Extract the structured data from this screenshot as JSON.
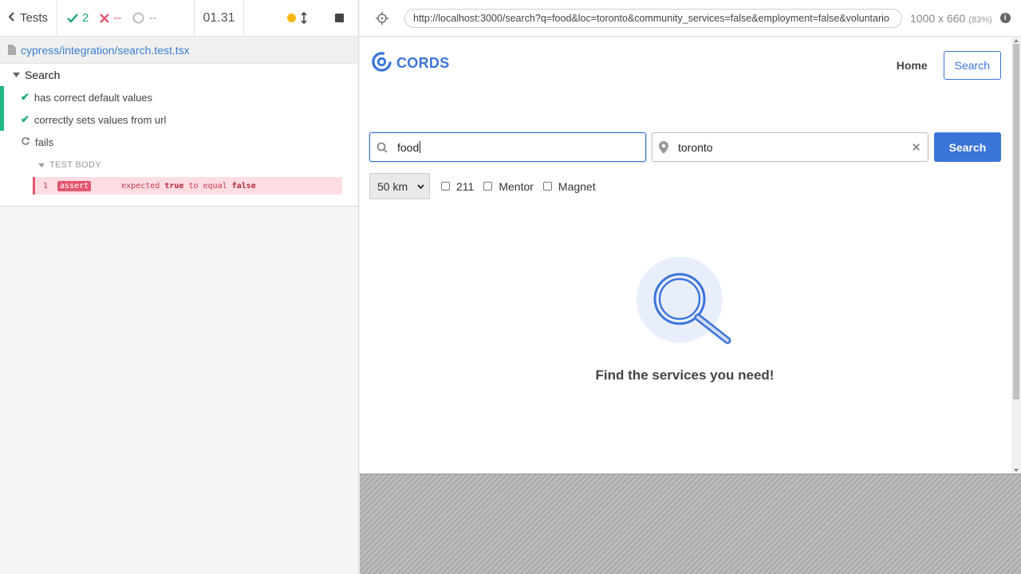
{
  "runner": {
    "back_label": "Tests",
    "passed": "2",
    "failed": "--",
    "pending": "--",
    "duration": "01.31",
    "spec_file": "cypress/integration/search.test.tsx",
    "suite_title": "Search",
    "tests": [
      {
        "title": "has correct default values",
        "state": "passed"
      },
      {
        "title": "correctly sets values from url",
        "state": "passed"
      },
      {
        "title": "fails",
        "state": "running"
      }
    ],
    "test_body_label": "TEST BODY",
    "command": {
      "number": "1",
      "name": "assert",
      "msg_expected": "expected",
      "msg_true": "true",
      "msg_to_equal": "to equal",
      "msg_false": "false"
    }
  },
  "aut": {
    "url": "http://localhost:3000/search?q=food&loc=toronto&community_services=false&employment=false&voluntario",
    "viewport": "1000 x 660",
    "zoom": "(83%)"
  },
  "app": {
    "logo_text": "CORDS",
    "nav": {
      "home": "Home",
      "search": "Search"
    },
    "query_value": "food",
    "location_value": "toronto",
    "search_button": "Search",
    "distance": "50 km",
    "checkboxes": [
      "211",
      "Mentor",
      "Magnet"
    ],
    "empty_message": "Find the services you need!"
  },
  "colors": {
    "brand": "#3a74d9",
    "pass": "#1aa77a",
    "fail": "#e45770"
  }
}
